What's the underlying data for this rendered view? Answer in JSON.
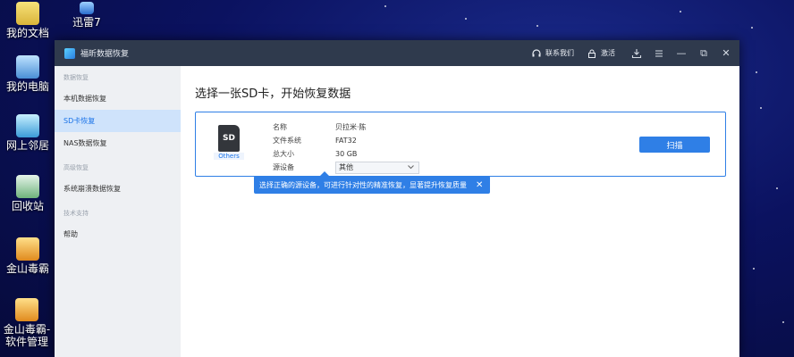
{
  "desktop": {
    "icons": [
      {
        "label": "我的文档",
        "icon": "folder-icon"
      },
      {
        "label": "迅雷7",
        "icon": "thunder-icon"
      },
      {
        "label": "我的电脑",
        "icon": "computer-icon"
      },
      {
        "label": "网上邻居",
        "icon": "network-icon"
      },
      {
        "label": "回收站",
        "icon": "recycle-bin-icon"
      },
      {
        "label": "金山毒霸",
        "icon": "antivirus-icon"
      },
      {
        "label": "金山毒霸-软件管理",
        "icon": "software-manager-icon"
      }
    ]
  },
  "window": {
    "title": "福昕数据恢复",
    "contact": "联系我们",
    "activate": "激活",
    "controls": {
      "minimize": "—",
      "restore": "⧉",
      "close": "✕"
    }
  },
  "sidebar": {
    "groups": [
      {
        "title": "数据恢复",
        "items": [
          "本机数据恢复",
          "SD卡恢复",
          "NAS数据恢复"
        ]
      },
      {
        "title": "高级恢复",
        "items": [
          "系统崩溃数据恢复"
        ]
      },
      {
        "title": "技术支持",
        "items": [
          "帮助"
        ]
      }
    ],
    "active": "SD卡恢复"
  },
  "main": {
    "heading": "选择一张SD卡，开始恢复数据",
    "card": {
      "sd_text": "SD",
      "sd_label": "Others",
      "props": [
        {
          "key": "名称",
          "value": "贝拉米·陈"
        },
        {
          "key": "文件系统",
          "value": "FAT32"
        },
        {
          "key": "总大小",
          "value": "30 GB"
        },
        {
          "key": "源设备",
          "value": "其他"
        }
      ],
      "scan_button": "扫描"
    },
    "tooltip": "选择正确的源设备，可进行针对性的精准恢复，显著提升恢复质量"
  }
}
